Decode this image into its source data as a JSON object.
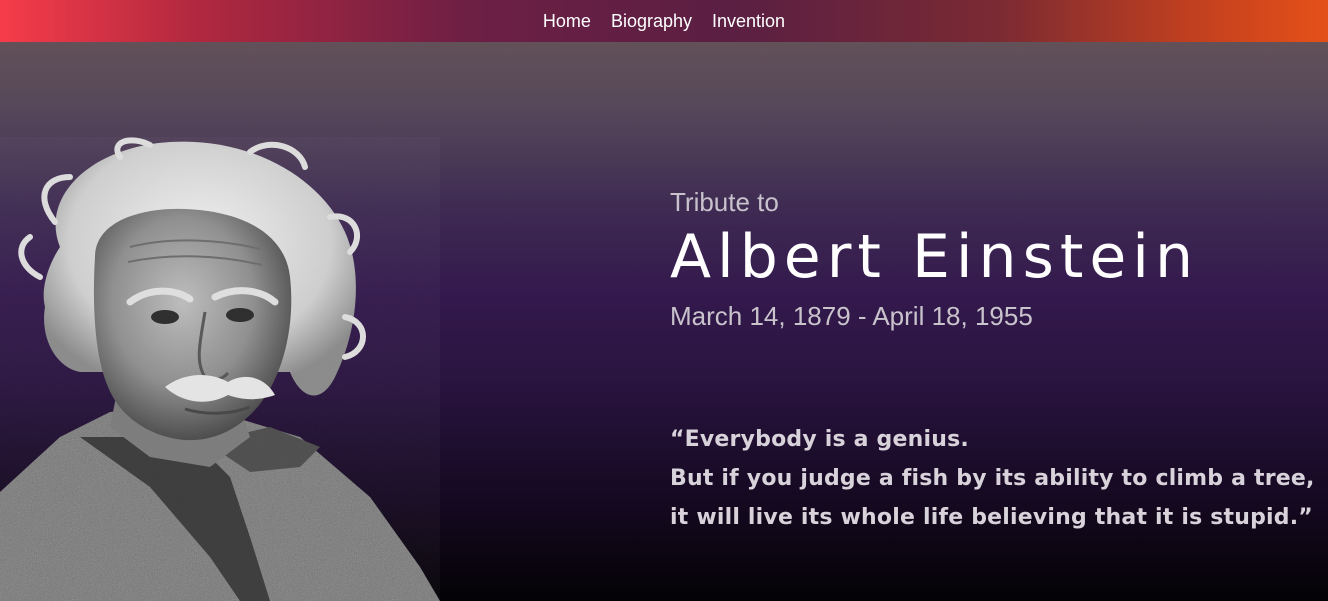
{
  "nav": {
    "links": [
      "Home",
      "Biography",
      "Invention"
    ]
  },
  "hero": {
    "tribute": "Tribute to",
    "name": "Albert Einstein",
    "dates": "March 14, 1879 - April 18, 1955",
    "quote_lines": [
      "“Everybody is a genius.",
      "But if you judge a fish by its ability to climb a tree,",
      "it will live its whole life believing that it is stupid.”"
    ],
    "portrait": "albert-einstein-portrait"
  },
  "colors": {
    "nav_gradient_start": "#f63c4a",
    "nav_gradient_end": "#e55019",
    "hero_top": "#625158",
    "hero_mid": "#33194d",
    "hero_bottom": "#040205"
  }
}
